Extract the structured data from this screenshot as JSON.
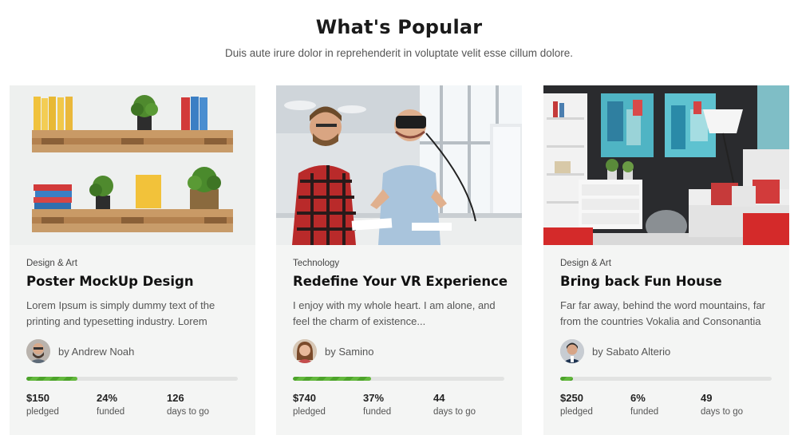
{
  "section": {
    "title": "What's Popular",
    "subtitle": "Duis aute irure dolor in reprehenderit in voluptate velit esse cillum dolore."
  },
  "colors": {
    "progress_green": "#4ca32a",
    "card_bg": "#f4f5f4",
    "track": "#e2e3e2"
  },
  "cards": [
    {
      "category": "Design & Art",
      "title": "Poster MockUp Design",
      "description": "Lorem Ipsum is simply dummy text of the printing and typesetting industry. Lorem",
      "author": "by Andrew Noah",
      "progress": 0.24,
      "stats": [
        {
          "value": "$150",
          "label": "pledged"
        },
        {
          "value": "24%",
          "label": "funded"
        },
        {
          "value": "126",
          "label": "days to go"
        }
      ]
    },
    {
      "category": "Technology",
      "title": "Redefine Your VR Experience",
      "description": "I enjoy with my whole heart. I am alone, and feel the charm of existence...",
      "author": "by Samino",
      "progress": 0.37,
      "stats": [
        {
          "value": "$740",
          "label": "pledged"
        },
        {
          "value": "37%",
          "label": "funded"
        },
        {
          "value": "44",
          "label": "days to go"
        }
      ]
    },
    {
      "category": "Design & Art",
      "title": "Bring back Fun House",
      "description": "Far far away, behind the word mountains, far from the countries Vokalia and Consonantia",
      "author": "by Sabato Alterio",
      "progress": 0.06,
      "stats": [
        {
          "value": "$250",
          "label": "pledged"
        },
        {
          "value": "6%",
          "label": "funded"
        },
        {
          "value": "49",
          "label": "days to go"
        }
      ]
    }
  ]
}
